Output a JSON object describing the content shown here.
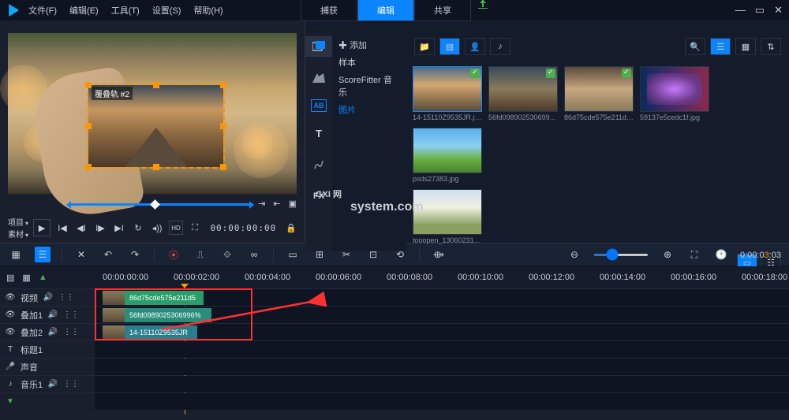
{
  "menu": {
    "file": "文件(F)",
    "edit": "编辑(E)",
    "tool": "工具(T)",
    "settings": "设置(S)",
    "help": "帮助(H)"
  },
  "tabs": {
    "capture": "捕获",
    "edit": "编辑",
    "share": "共享"
  },
  "preview": {
    "overlay_label": "覆叠轨 #2"
  },
  "playback": {
    "project": "项目",
    "material": "素材",
    "timecode": "00:00:00:00"
  },
  "sidebar": {
    "add": "添加",
    "sample": "样本",
    "scorefitter": "ScoreFitter 音乐",
    "images": "图片"
  },
  "thumbs": [
    {
      "name": "14-15110Z9535JR.jpg"
    },
    {
      "name": "56fd098902530699..."
    },
    {
      "name": "86d75cde575e211d5..."
    },
    {
      "name": "59137e5cedc1f.jpg"
    },
    {
      "name": "psds27383.jpg"
    },
    {
      "name": "tooopen_13060231.jpg"
    }
  ],
  "ruler": [
    "00:00:00:00",
    "00:00:02:00",
    "00:00:04:00",
    "00:00:06:00",
    "00:00:08:00",
    "00:00:10:00",
    "00:00:12:00",
    "00:00:14:00",
    "00:00:16:00",
    "00:00:18:00"
  ],
  "tracks": {
    "video": "视频",
    "overlay1": "叠加1",
    "overlay2": "叠加2",
    "title1": "标题1",
    "voice": "声音",
    "music1": "音乐1"
  },
  "clips": {
    "c1": "86d75cde575e211d5",
    "c2": "56fd0989025306996%",
    "c3": "14-15110Z9535JR"
  },
  "toolbar_tc": {
    "pre": "0:00:0",
    "hl": "3",
    "post": ":03"
  },
  "watermark": {
    "main": "GXI 网",
    "sub": "system.com"
  }
}
